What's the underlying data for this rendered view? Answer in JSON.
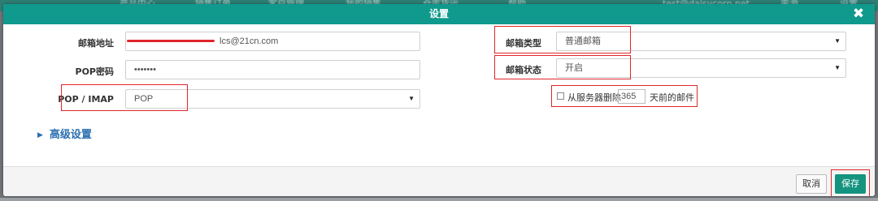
{
  "background_nav": {
    "items": [
      "产品中心",
      "销售订单",
      "客户管理",
      "我的销售",
      "仓库货运",
      "帮助",
      "test@daisycorp.net",
      "来源",
      "设置"
    ]
  },
  "modal": {
    "title": "设置",
    "close_icon": "close-icon"
  },
  "form": {
    "email_address": {
      "label": "邮箱地址",
      "value": "lcs@21cn.com"
    },
    "pop_password": {
      "label": "POP密码",
      "value": "•••••••"
    },
    "pop_imap": {
      "label": "POP / IMAP",
      "value": "POP"
    },
    "mailbox_type": {
      "label": "邮箱类型",
      "value": "普通邮箱"
    },
    "mailbox_status": {
      "label": "邮箱状态",
      "value": "开启"
    },
    "delete_from_server": {
      "prefix": "从服务器删除",
      "days": "365",
      "suffix": "天前的邮件",
      "checked": false
    }
  },
  "advanced": {
    "label": "高级设置"
  },
  "footer": {
    "cancel_label": "取消",
    "save_label": "保存"
  },
  "colors": {
    "header": "#0f9a8d",
    "save_button": "#14947f",
    "highlight": "#e0262c",
    "link": "#2a6fb0"
  }
}
